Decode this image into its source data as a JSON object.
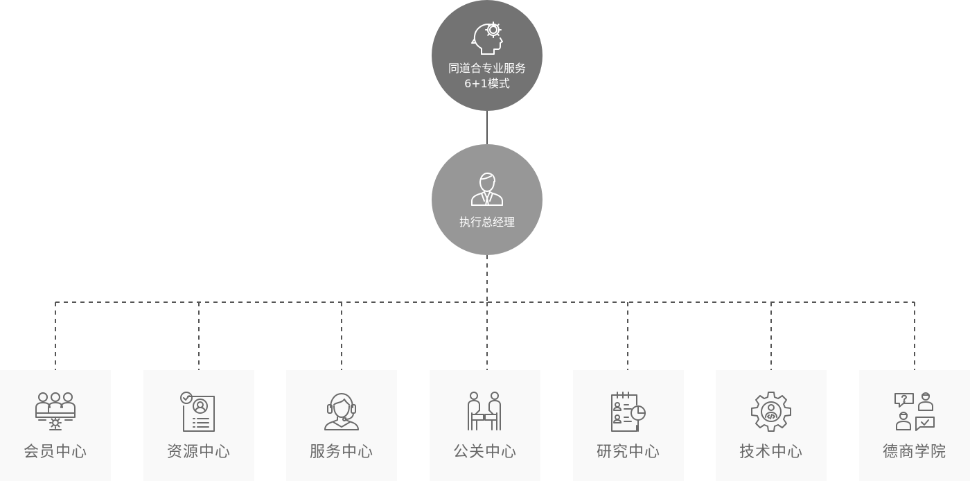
{
  "top_node": {
    "title_line1": "同道合专业服务",
    "title_line2": "6+1模式",
    "icon": "head-gear-icon"
  },
  "middle_node": {
    "title": "执行总经理",
    "icon": "executive-person-icon"
  },
  "departments": [
    {
      "label": "会员中心",
      "icon": "member-group-icon"
    },
    {
      "label": "资源中心",
      "icon": "resource-profile-icon"
    },
    {
      "label": "服务中心",
      "icon": "headset-agent-icon"
    },
    {
      "label": "公关中心",
      "icon": "public-relations-icon"
    },
    {
      "label": "研究中心",
      "icon": "research-report-icon"
    },
    {
      "label": "技术中心",
      "icon": "tech-gear-icon"
    },
    {
      "label": "德商学院",
      "icon": "academy-qa-icon"
    }
  ],
  "colors": {
    "top_circle": "#737373",
    "middle_circle": "#979797",
    "dept_background": "#f9f9f9",
    "dept_text": "#666666",
    "connector": "#555555",
    "icon_stroke": "#6b6b6b"
  }
}
